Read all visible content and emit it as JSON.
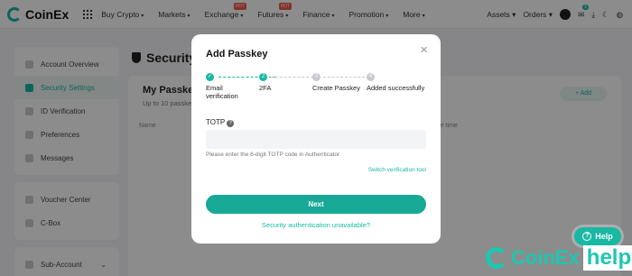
{
  "brand": {
    "name": "CoinEx",
    "accent": "#18b8a3"
  },
  "nav": {
    "items": [
      {
        "label": "Buy Crypto",
        "hot": false
      },
      {
        "label": "Markets",
        "hot": false
      },
      {
        "label": "Exchange",
        "hot": true
      },
      {
        "label": "Futures",
        "hot": true
      },
      {
        "label": "Finance",
        "hot": false
      },
      {
        "label": "Promotion",
        "hot": false
      },
      {
        "label": "More",
        "hot": false
      }
    ],
    "hot_badge": "HOT",
    "assets": "Assets",
    "orders": "Orders",
    "notification_count": "6"
  },
  "sidebar": {
    "group1": [
      "Account Overview",
      "Security Settings",
      "ID Verification",
      "Preferences",
      "Messages"
    ],
    "group2": [
      "Voucher Center",
      "C-Box"
    ],
    "group3": [
      "Sub-Account"
    ]
  },
  "page": {
    "title": "Security",
    "card_title": "My Passkey",
    "card_sub": "Up to 10 passke",
    "add_label": "+ Add",
    "col_name": "Name",
    "col_time": "ge time"
  },
  "modal": {
    "title": "Add Passkey",
    "steps": [
      {
        "num": "✓",
        "label": "Email verification",
        "state": "done"
      },
      {
        "num": "2",
        "label": "2FA",
        "state": "current"
      },
      {
        "num": "3",
        "label": "Create Passkey",
        "state": "todo"
      },
      {
        "num": "4",
        "label": "Added successfully",
        "state": "todo"
      }
    ],
    "totp_label": "TOTP",
    "totp_value": "",
    "hint": "Please enter the 6-digit TOTP code in Authenticator",
    "switch_link": "Switch verification tool",
    "next_label": "Next",
    "unavailable_link": "Security authentication unavailable?"
  },
  "help": {
    "label": "Help"
  },
  "watermark": {
    "brand": "CoinEx",
    "help": "help"
  }
}
